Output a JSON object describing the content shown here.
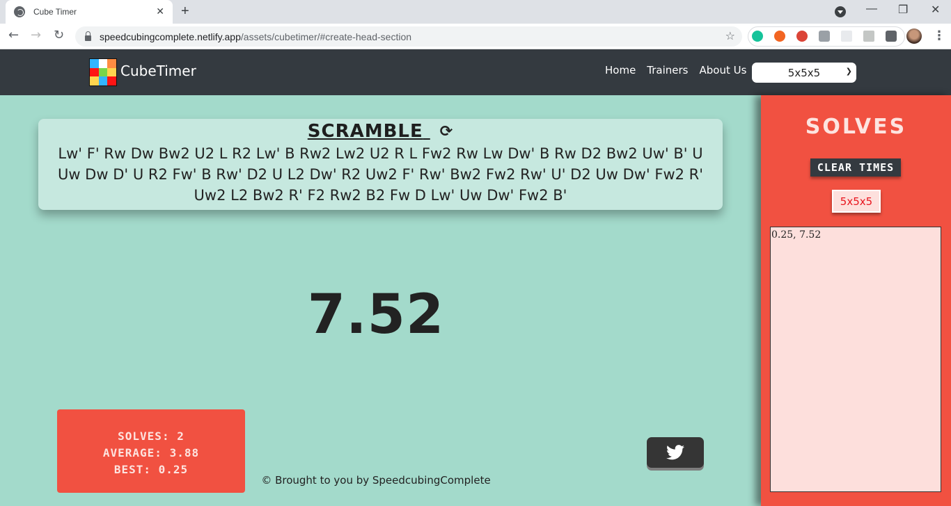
{
  "browser": {
    "tab_title": "Cube Timer",
    "url_domain": "speedcubingcomplete.netlify.app",
    "url_path": "/assets/cubetimer/#create-head-section",
    "extensions": [
      {
        "name": "grammarly-icon",
        "color": "#15c39a"
      },
      {
        "name": "orange-ext-icon",
        "color": "#f26522"
      },
      {
        "name": "download-ext-icon",
        "color": "#db4437"
      },
      {
        "name": "camera-ext-icon",
        "color": "#9aa0a6"
      },
      {
        "name": "react-ext-icon",
        "color": "#e8eaed"
      },
      {
        "name": "notes-ext-icon",
        "color": "#c4c7c5"
      },
      {
        "name": "puzzle-icon",
        "color": "#5f6368"
      }
    ]
  },
  "header": {
    "brand": "CubeTimer",
    "logo_colors": [
      "#33b5ff",
      "#ffffff",
      "#ff8c42",
      "#ff1414",
      "#78d64b",
      "#ffd54f",
      "#ffd54f",
      "#33b5ff",
      "#ff1414"
    ],
    "nav": [
      "Home",
      "Trainers",
      "About Us"
    ],
    "cube_select": "5x5x5"
  },
  "scramble": {
    "title": "SCRAMBLE",
    "text": "Lw' F' Rw Dw Bw2 U2 L R2 Lw' B Rw2 Lw2 U2 R L Fw2 Rw Lw Dw' B Rw D2 Bw2 Uw' B' U Uw Dw D' U R2 Fw' B Rw' D2 U L2 Dw' R2 Uw2 F' Rw' Bw2 Fw2 Rw' U' D2 Uw Dw' Fw2 R' Uw2 L2 Bw2 R' F2 Rw2 B2 Fw D Lw' Uw Dw' Fw2 B'"
  },
  "timer": {
    "value": "7.52"
  },
  "stats": {
    "solves": "SOLVES: 2",
    "average": "AVERAGE: 3.88",
    "best": "BEST: 0.25"
  },
  "footer": {
    "text": "© Brought to you by SpeedcubingComplete"
  },
  "side": {
    "title": "SOLVES",
    "clear_label": "CLEAR TIMES",
    "cube_tag": "5x5x5",
    "times": "0.25, 7.52"
  },
  "colors": {
    "page_bg": "#a3dacb",
    "header_bg": "#343a40",
    "accent_red": "#f15141",
    "scramble_bg": "#c6e8df"
  }
}
